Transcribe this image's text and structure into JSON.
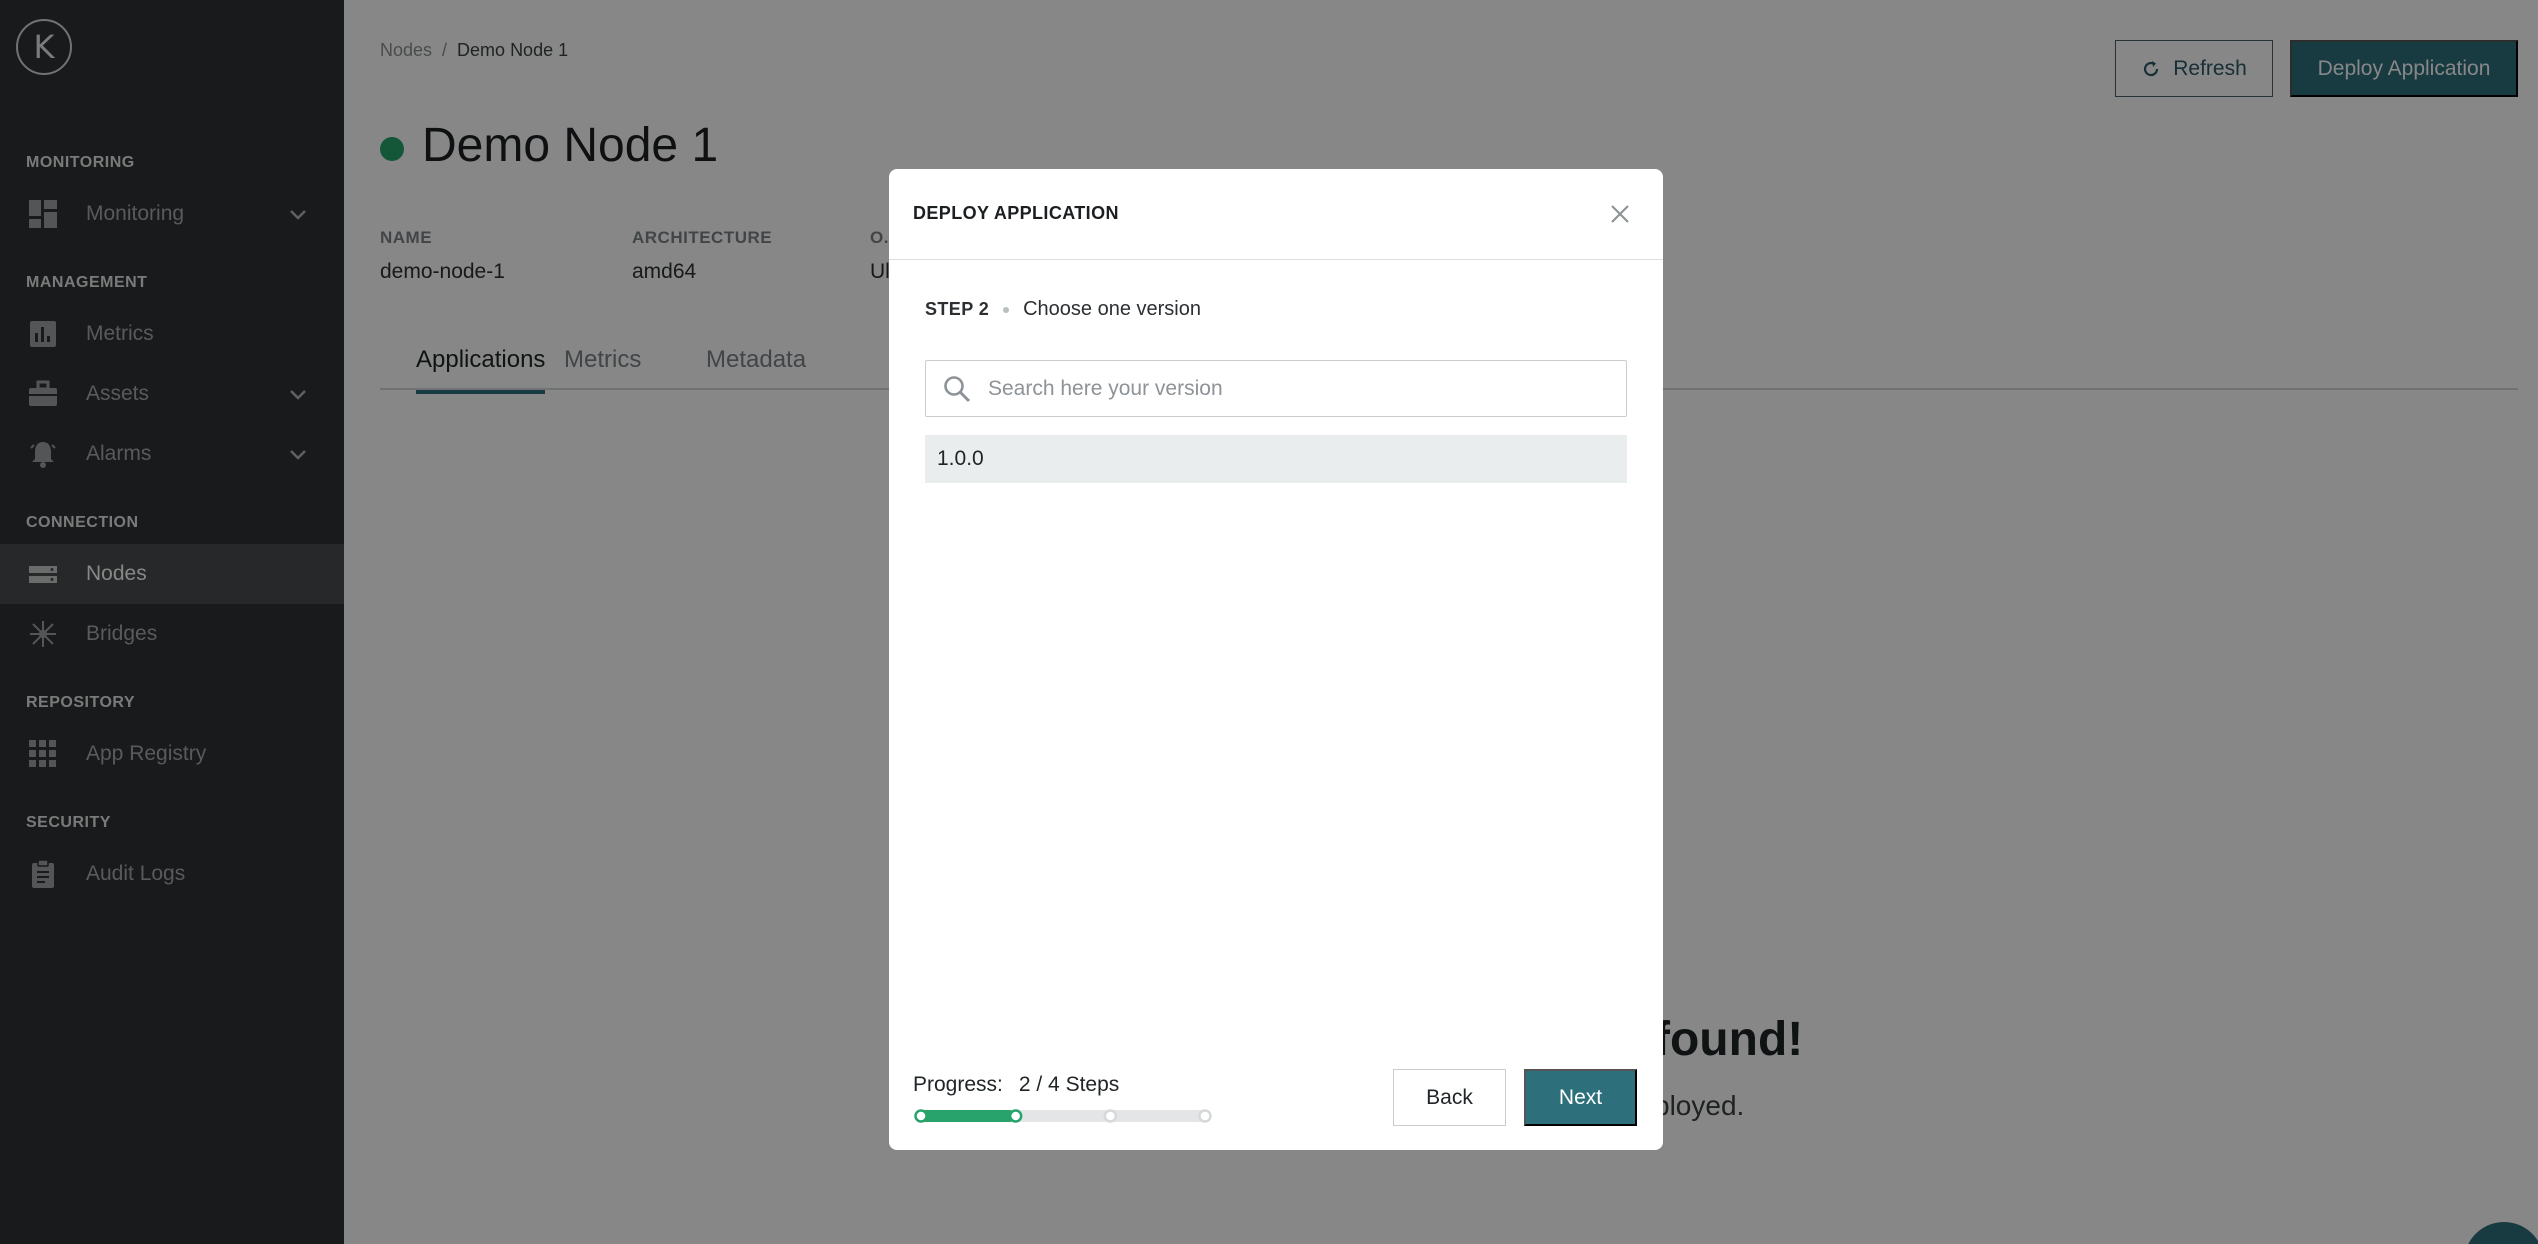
{
  "sidebar": {
    "logo_text": "K",
    "sections": [
      {
        "title": "MONITORING"
      },
      {
        "title": "MANAGEMENT"
      },
      {
        "title": "CONNECTION"
      },
      {
        "title": "REPOSITORY"
      },
      {
        "title": "SECURITY"
      }
    ],
    "items": [
      {
        "label": "Monitoring",
        "icon": "dashboard-icon",
        "has_chevron": true
      },
      {
        "label": "Metrics",
        "icon": "bar-chart-icon"
      },
      {
        "label": "Assets",
        "icon": "briefcase-icon",
        "has_chevron": true
      },
      {
        "label": "Alarms",
        "icon": "alarm-bell-icon",
        "has_chevron": true
      },
      {
        "label": "Nodes",
        "icon": "server-icon",
        "active": true
      },
      {
        "label": "Bridges",
        "icon": "network-hub-icon"
      },
      {
        "label": "App Registry",
        "icon": "grid-apps-icon"
      },
      {
        "label": "Audit Logs",
        "icon": "clipboard-icon"
      }
    ]
  },
  "breadcrumb": {
    "root": "Nodes",
    "separator": "/",
    "current": "Demo Node 1"
  },
  "header": {
    "refresh_label": "Refresh",
    "deploy_label": "Deploy Application"
  },
  "node": {
    "title": "Demo Node 1",
    "status_color": "#27a36b",
    "props": [
      {
        "label": "NAME",
        "value": "demo-node-1"
      },
      {
        "label": "ARCHITECTURE",
        "value": "amd64"
      },
      {
        "label": "O.",
        "value": "Ul"
      }
    ]
  },
  "tabs": [
    {
      "label": "Applications",
      "active": true
    },
    {
      "label": "Metrics"
    },
    {
      "label": "Metadata"
    }
  ],
  "empty_state": {
    "title_fragment": "found!",
    "subtitle_fragment": "ployed."
  },
  "modal": {
    "title": "DEPLOY APPLICATION",
    "step_label": "STEP 2",
    "step_text": "Choose one version",
    "search_placeholder": "Search here your version",
    "versions": [
      "1.0.0"
    ],
    "progress_label": "Progress:",
    "progress_text": "2 / 4 Steps",
    "progress_current_step": 2,
    "progress_total_steps": 4,
    "back_label": "Back",
    "next_label": "Next"
  },
  "colors": {
    "accent": "#2e6f7c",
    "success": "#27a36b",
    "sidebar_bg": "#2f3133"
  }
}
